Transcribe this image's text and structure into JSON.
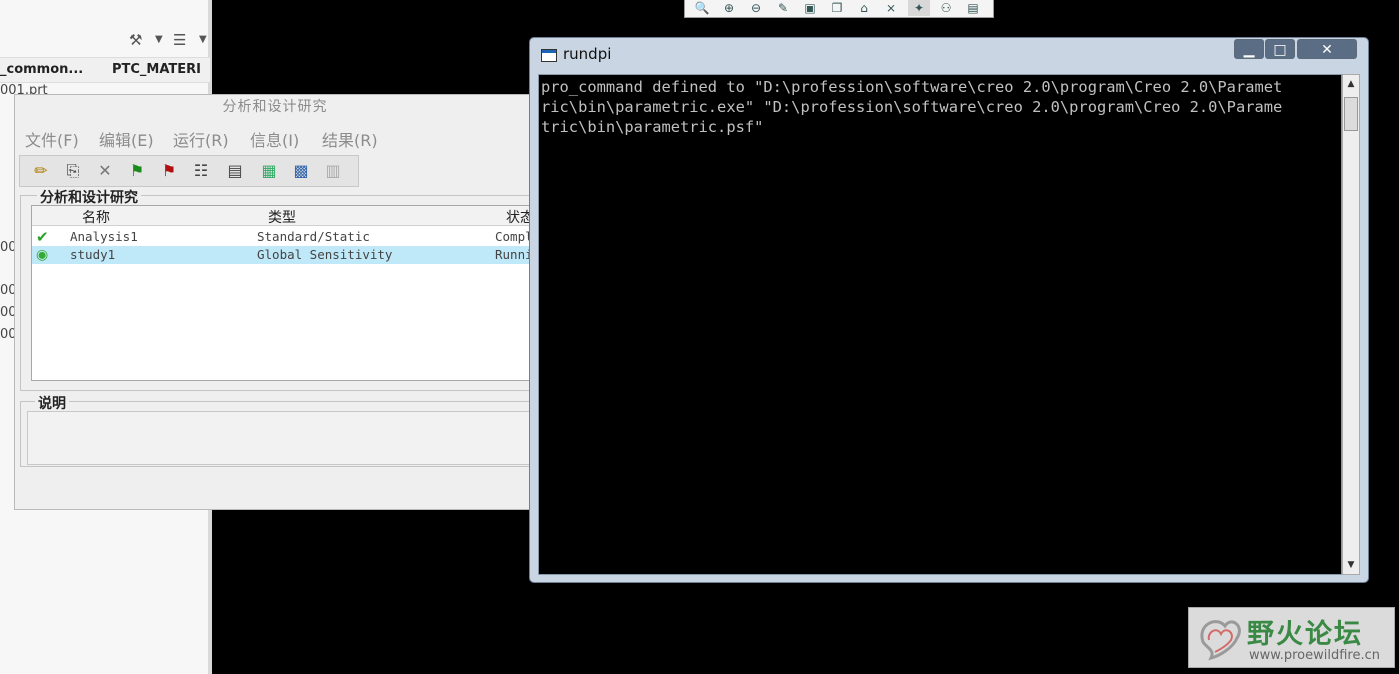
{
  "model_tree": {
    "columns": [
      "_common...",
      "PTC_MATERI"
    ],
    "rows": [
      "001.prt",
      "00",
      "00",
      "00",
      "00"
    ]
  },
  "top_toolbar": {
    "icons": [
      "zoom-window-icon",
      "zoom-in-icon",
      "zoom-out-icon",
      "repaint-icon",
      "refit-icon",
      "orient-icon",
      "saved-views-icon",
      "datum-display-icon",
      "spin-center-icon",
      "network-icon",
      "layers-icon"
    ]
  },
  "dialog": {
    "title": "分析和设计研究",
    "menu": [
      "文件(F)",
      "编辑(E)",
      "运行(R)",
      "信息(I)",
      "结果(R)"
    ],
    "group_label": "分析和设计研究",
    "columns": [
      "名称",
      "类型",
      "状态"
    ],
    "rows": [
      {
        "name": "Analysis1",
        "type": "Standard/Static",
        "status": "Compl",
        "icon": "checkmark-icon"
      },
      {
        "name": "study1",
        "type": "Global Sensitivity",
        "status": "Runni",
        "icon": "running-icon"
      }
    ],
    "desc_label": "说明"
  },
  "console": {
    "title": "rundpi",
    "text": "pro_command defined to \"D:\\profession\\software\\creo 2.0\\program\\Creo 2.0\\Paramet\nric\\bin\\parametric.exe\" \"D:\\profession\\software\\creo 2.0\\program\\Creo 2.0\\Parame\ntric\\bin\\parametric.psf\"",
    "buttons": {
      "minimize": "▁",
      "maximize": "□",
      "close": "✕"
    }
  },
  "watermark": {
    "name": "野火论坛",
    "url": "www.proewildfire.cn"
  },
  "colors": {
    "selection": "#bfe8f8",
    "console_bg": "#000000",
    "brand_green": "#3a8a46"
  }
}
